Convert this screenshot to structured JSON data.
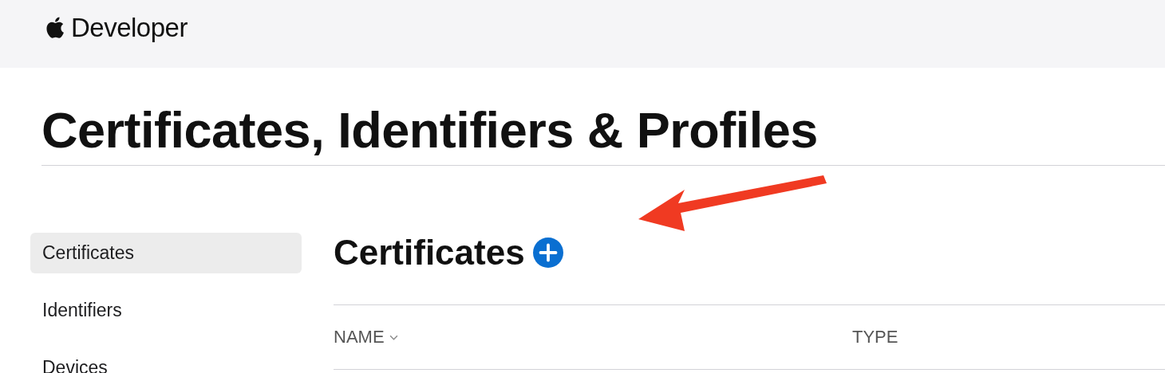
{
  "header": {
    "brand": "Developer"
  },
  "page_title": "Certificates, Identifiers & Profiles",
  "sidebar": {
    "items": [
      {
        "label": "Certificates",
        "selected": true
      },
      {
        "label": "Identifiers",
        "selected": false
      },
      {
        "label": "Devices",
        "selected": false
      }
    ]
  },
  "section": {
    "title": "Certificates"
  },
  "table": {
    "columns": [
      {
        "label": "NAME",
        "sorted": true
      },
      {
        "label": "TYPE",
        "sorted": false
      }
    ]
  }
}
